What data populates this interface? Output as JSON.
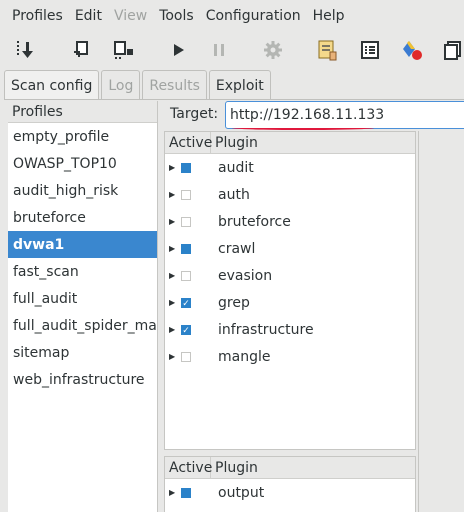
{
  "menubar": {
    "items": [
      "Profiles",
      "Edit",
      "View",
      "Tools",
      "Configuration",
      "Help"
    ]
  },
  "toolbar": {
    "buttons": [
      "new-profile-icon",
      "save-profile-icon",
      "save-as-icon",
      "start-icon",
      "pause-icon",
      "settings-icon",
      "report-icon",
      "list-icon",
      "plugins-icon",
      "copy-icon"
    ]
  },
  "tabs": [
    "Scan config",
    "Log",
    "Results",
    "Exploit"
  ],
  "profiles": {
    "header": "Profiles",
    "items": [
      "empty_profile",
      "OWASP_TOP10",
      "audit_high_risk",
      "bruteforce",
      "dvwa1",
      "fast_scan",
      "full_audit",
      "full_audit_spider_man",
      "sitemap",
      "web_infrastructure"
    ],
    "selected": "dvwa1"
  },
  "target": {
    "label": "Target:",
    "value": "http://192.168.11.133"
  },
  "plugins_table": {
    "col_active": "Active",
    "col_plugin": "Plugin",
    "rows": [
      {
        "name": "audit",
        "state": "partial"
      },
      {
        "name": "auth",
        "state": "off"
      },
      {
        "name": "bruteforce",
        "state": "off"
      },
      {
        "name": "crawl",
        "state": "partial"
      },
      {
        "name": "evasion",
        "state": "off"
      },
      {
        "name": "grep",
        "state": "checked"
      },
      {
        "name": "infrastructure",
        "state": "checked"
      },
      {
        "name": "mangle",
        "state": "off"
      }
    ]
  },
  "output_table": {
    "col_active": "Active",
    "col_plugin": "Plugin",
    "rows": [
      {
        "name": "output",
        "state": "partial"
      }
    ]
  },
  "colors": {
    "selection": "#3a87cf",
    "check": "#2b82c9",
    "annotation": "#e0183c"
  }
}
